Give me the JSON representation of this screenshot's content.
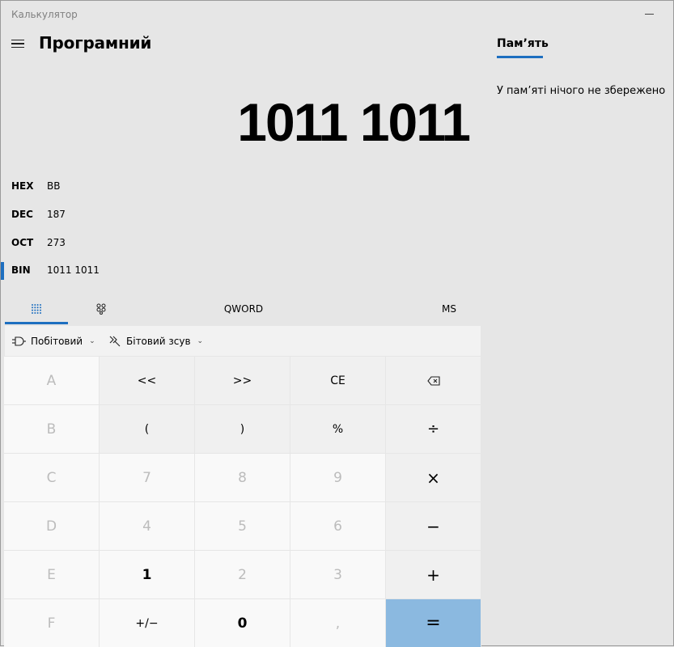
{
  "window": {
    "title": "Калькулятор"
  },
  "header": {
    "mode_title": "Програмний"
  },
  "display": {
    "value": "1011 1011"
  },
  "radix": [
    {
      "label": "HEX",
      "value": "BB",
      "active": false
    },
    {
      "label": "DEC",
      "value": "187",
      "active": false
    },
    {
      "label": "OCT",
      "value": "273",
      "active": false
    },
    {
      "label": "BIN",
      "value": "1011 1011",
      "active": true
    }
  ],
  "keypad_tabs": {
    "word_size": "QWORD",
    "memory_store": "MS"
  },
  "ops_bar": {
    "bitwise": "Побітовий",
    "bit_shift": "Бітовий зсув"
  },
  "keys": {
    "A": "A",
    "lsh": "<<",
    "rsh": ">>",
    "ce": "CE",
    "B": "B",
    "lparen": "(",
    "rparen": ")",
    "percent": "%",
    "divide": "÷",
    "C": "C",
    "n7": "7",
    "n8": "8",
    "n9": "9",
    "multiply": "×",
    "D": "D",
    "n4": "4",
    "n5": "5",
    "n6": "6",
    "minus": "−",
    "E": "E",
    "n1": "1",
    "n2": "2",
    "n3": "3",
    "plus": "+",
    "F": "F",
    "negate": "+/−",
    "n0": "0",
    "decimal": ",",
    "equals": "="
  },
  "memory": {
    "title": "Пам’ять",
    "empty_message": "У пам’яті нічого не збережено"
  },
  "colors": {
    "accent": "#1e6fc0",
    "equals_bg": "#8bb9e0",
    "background": "#e6e6e6"
  }
}
